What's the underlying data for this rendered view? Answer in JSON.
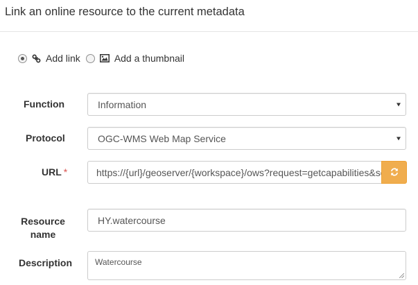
{
  "header": {
    "title": "Link an online resource to the current metadata"
  },
  "resource_type": {
    "options": [
      {
        "label": "Add link",
        "icon": "link-icon",
        "selected": true
      },
      {
        "label": "Add a thumbnail",
        "icon": "image-icon",
        "selected": false
      }
    ]
  },
  "form": {
    "function": {
      "label": "Function",
      "value": "Information"
    },
    "protocol": {
      "label": "Protocol",
      "value": "OGC-WMS Web Map Service"
    },
    "url": {
      "label": "URL",
      "required_marker": "*",
      "value": "https://{url}/geoserver/{workspace}/ows?request=getcapabilities&service=WMS",
      "button_icon": "refresh-icon",
      "button_color": "#f0ad4e"
    },
    "resource_name": {
      "label_line1": "Resource",
      "label_line2": "name",
      "value": "HY.watercourse"
    },
    "description": {
      "label": "Description",
      "value": "Watercourse"
    }
  }
}
